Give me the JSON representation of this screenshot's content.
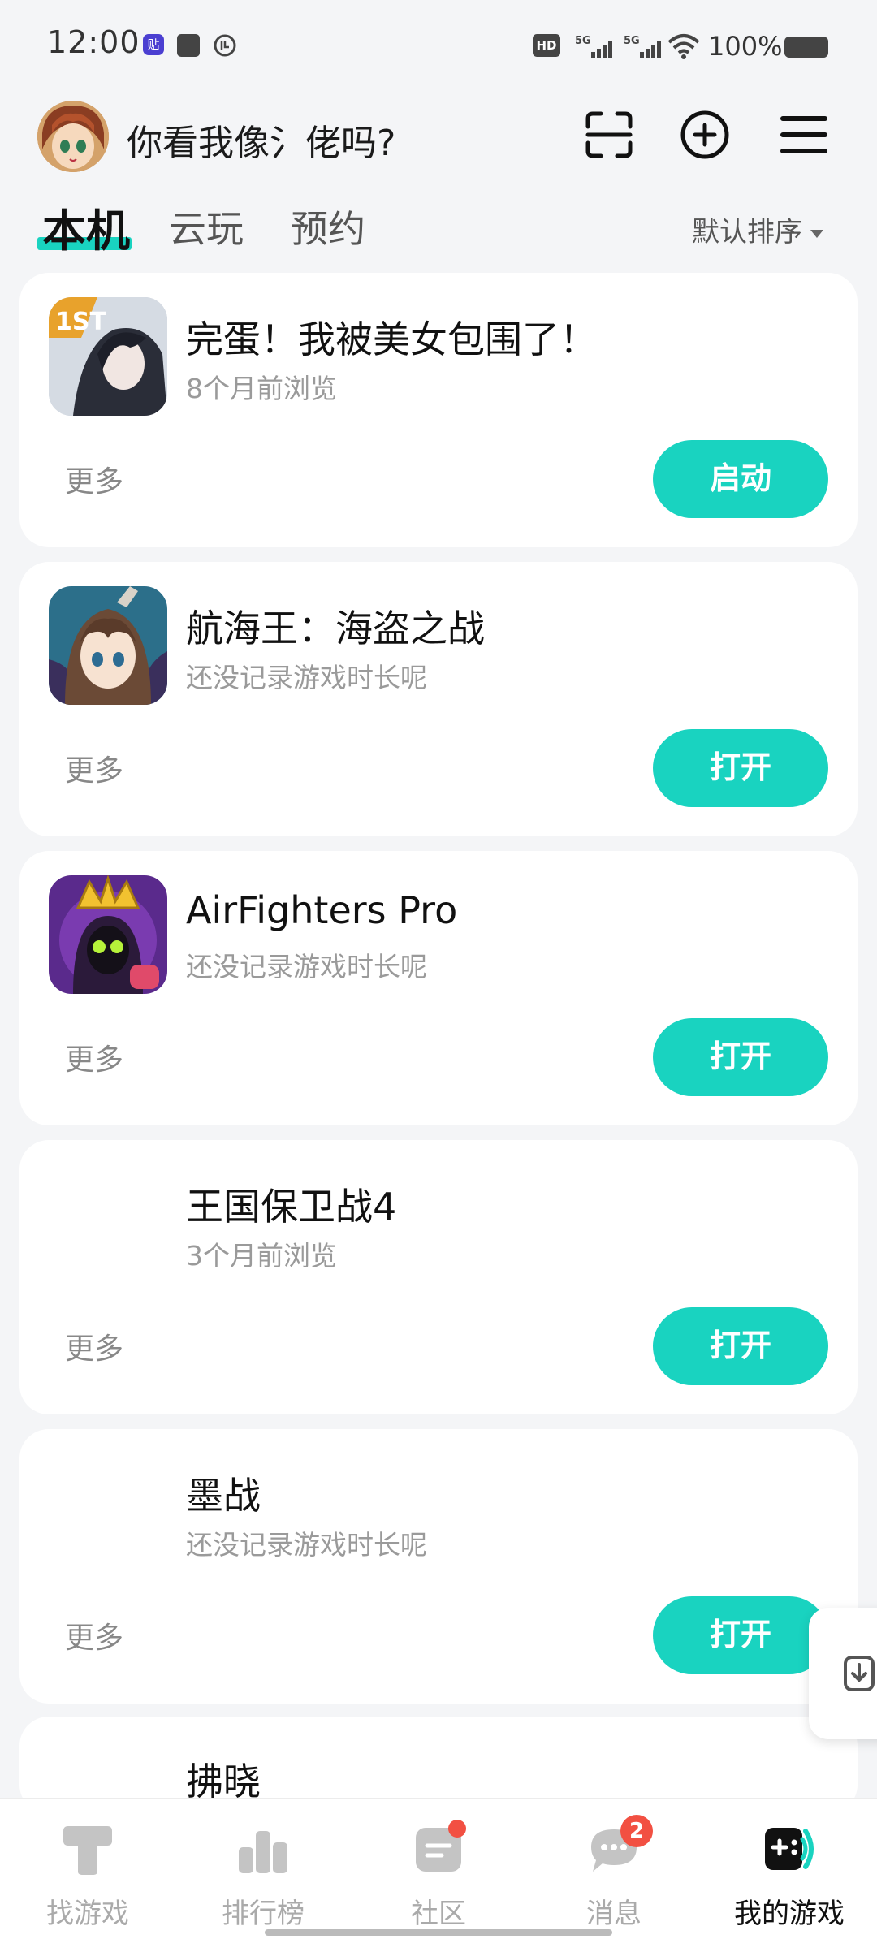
{
  "status_bar": {
    "time": "12:00",
    "notif_icon_text": "贴",
    "hd_text": "HD",
    "battery_text": "100%"
  },
  "header": {
    "title": "你看我像氵佬吗?",
    "icons": [
      "scan-icon",
      "plus-circle-icon",
      "menu-icon"
    ]
  },
  "tabs": {
    "local": "本机",
    "cloud": "云玩",
    "reserve": "预约",
    "sort_label": "默认排序"
  },
  "games": [
    {
      "name": "完蛋！我被美女包围了！",
      "sub": "8个月前浏览",
      "more": "更多",
      "action": "启动",
      "icon": "1st-game-icon"
    },
    {
      "name": "航海王：海盗之战",
      "sub": "还没记录游戏时长呢",
      "more": "更多",
      "action": "打开",
      "icon": "anime-girl-icon"
    },
    {
      "name": "AirFighters Pro",
      "sub": "还没记录游戏时长呢",
      "more": "更多",
      "action": "打开",
      "icon": "crown-skull-icon"
    },
    {
      "name": "王国保卫战4",
      "sub": "3个月前浏览",
      "more": "更多",
      "action": "打开",
      "icon": ""
    },
    {
      "name": "墨战",
      "sub": "还没记录游戏时长呢",
      "more": "更多",
      "action": "打开",
      "icon": ""
    },
    {
      "name": "拂晓"
    }
  ],
  "bottom_nav": {
    "items": [
      {
        "label": "找游戏",
        "icon": "find-game-icon"
      },
      {
        "label": "排行榜",
        "icon": "ranking-icon"
      },
      {
        "label": "社区",
        "icon": "community-icon"
      },
      {
        "label": "消息",
        "icon": "message-icon"
      },
      {
        "label": "我的游戏",
        "icon": "my-games-icon"
      }
    ],
    "message_badge": "2",
    "active": "我的游戏"
  },
  "colors": {
    "accent": "#19d3c0",
    "badge": "#f25042",
    "background": "#f4f5f7"
  }
}
